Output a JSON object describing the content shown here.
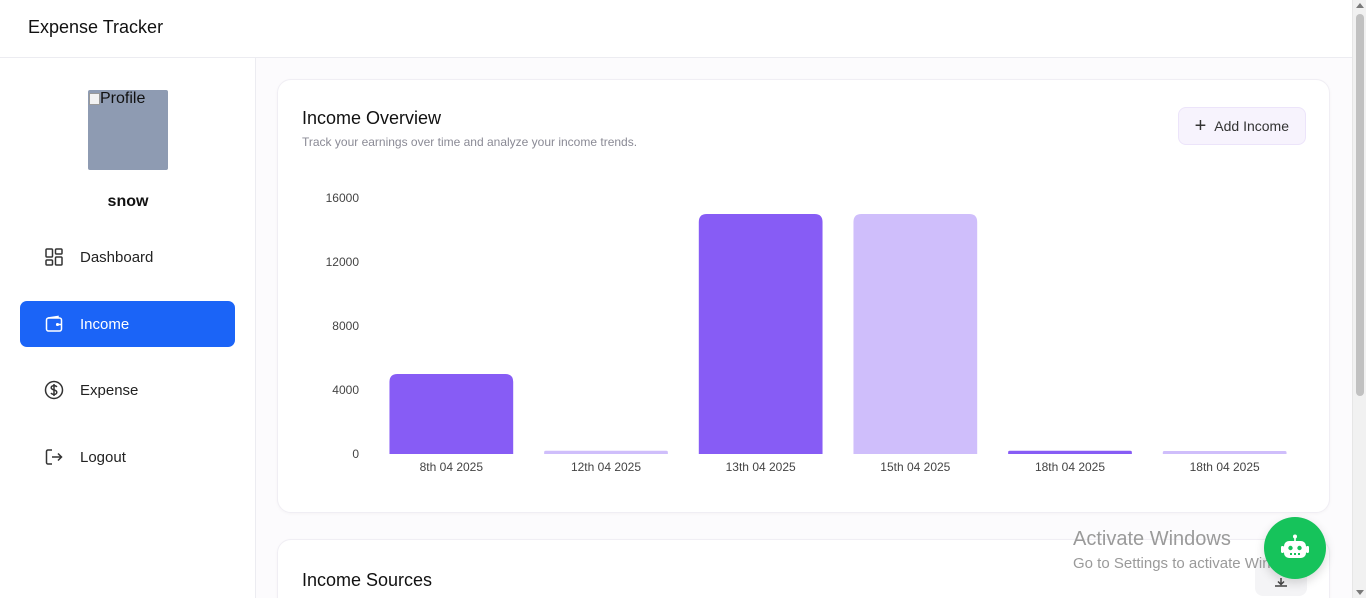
{
  "app": {
    "title": "Expense Tracker"
  },
  "sidebar": {
    "avatar_alt": "Profile",
    "user_name": "snow",
    "items": [
      {
        "label": "Dashboard",
        "icon": "dashboard-icon",
        "active": false
      },
      {
        "label": "Income",
        "icon": "wallet-icon",
        "active": true
      },
      {
        "label": "Expense",
        "icon": "dollar-circle-icon",
        "active": false
      },
      {
        "label": "Logout",
        "icon": "logout-icon",
        "active": false
      }
    ]
  },
  "overview": {
    "title": "Income Overview",
    "subtitle": "Track your earnings over time and analyze your income trends.",
    "add_button_label": "Add Income"
  },
  "chart_data": {
    "type": "bar",
    "title": "",
    "xlabel": "",
    "ylabel": "",
    "categories": [
      "8th 04 2025",
      "12th 04 2025",
      "13th 04 2025",
      "15th 04 2025",
      "18th 04 2025",
      "18th 04 2025"
    ],
    "values": [
      5000,
      200,
      15000,
      15000,
      200,
      150
    ],
    "yticks": [
      0,
      4000,
      8000,
      12000,
      16000
    ],
    "ylim": [
      0,
      16000
    ],
    "grid": false,
    "legend": "none",
    "colors": [
      "#875cf5",
      "#cfbefb",
      "#875cf5",
      "#cfbefb",
      "#875cf5",
      "#cfbefb"
    ]
  },
  "sources": {
    "title": "Income Sources"
  },
  "watermark": {
    "line1": "Activate Windows",
    "line2": "Go to Settings to activate Windows."
  },
  "colors": {
    "accent": "#1b64f7",
    "bar_primary": "#875cf5",
    "bar_secondary": "#cfbefb",
    "bot": "#16c35b"
  }
}
